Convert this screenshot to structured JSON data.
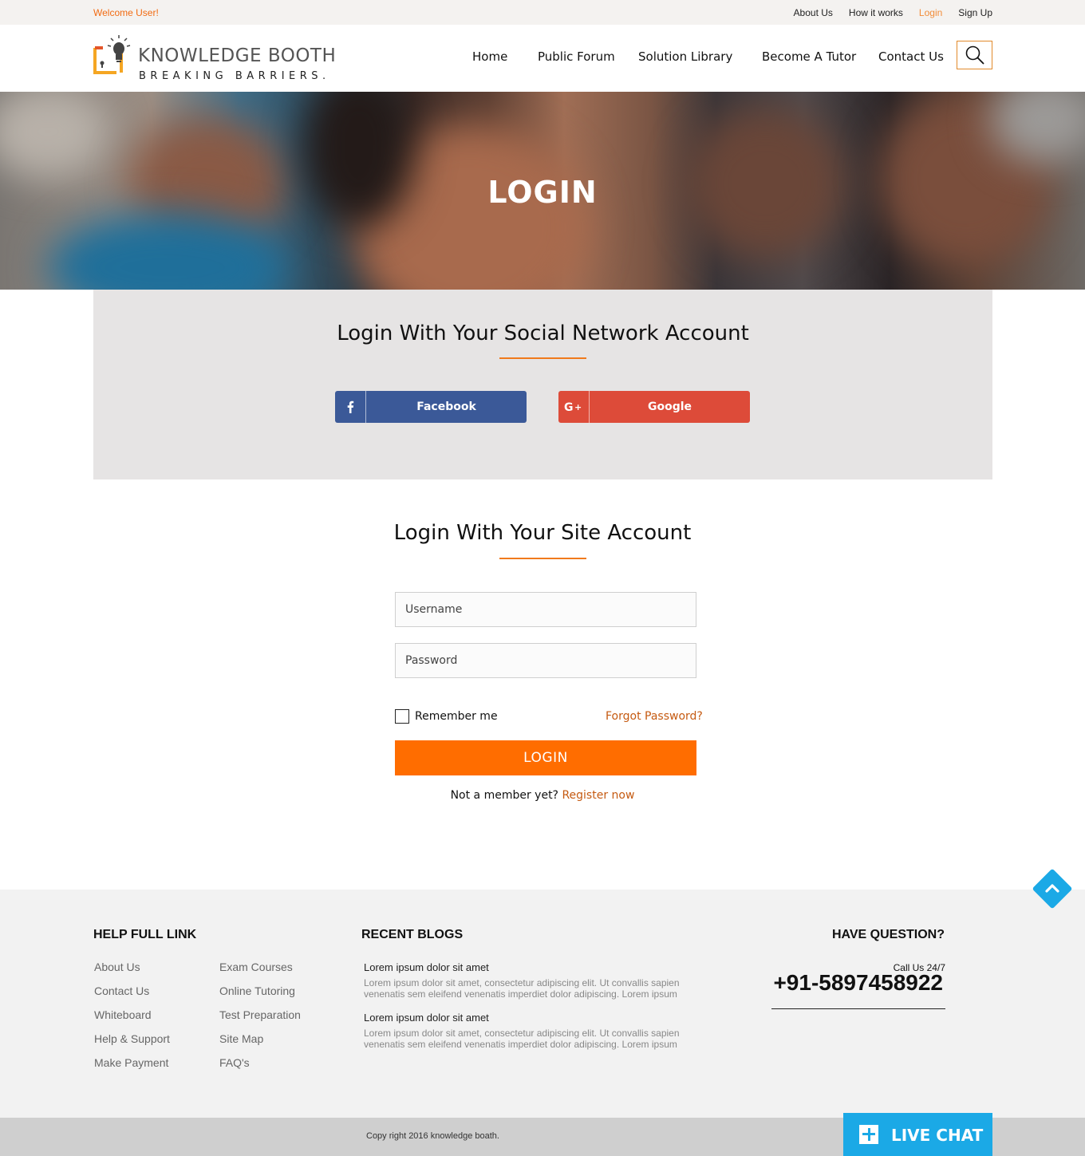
{
  "topbar": {
    "welcome": "Welcome User!",
    "links": [
      "About Us",
      "How it works",
      "Login",
      "Sign Up"
    ]
  },
  "brand": {
    "title": "KNOWLEDGE BOOTH",
    "tagline": "BREAKING BARRIERS."
  },
  "nav": {
    "items": [
      "Home",
      "Public Forum",
      "Solution Library",
      "Become A Tutor",
      "Contact Us"
    ]
  },
  "hero": {
    "title": "LOGIN"
  },
  "social": {
    "heading": "Login With Your Social Network Account",
    "facebook_label": "Facebook",
    "google_label": "Google",
    "facebook_color": "#3b5998",
    "google_color": "#dd4b39"
  },
  "site_login": {
    "heading": "Login With Your Site Account",
    "username_placeholder": "Username",
    "password_placeholder": "Password",
    "remember_label": "Remember me",
    "forgot_label": "Forgot Password?",
    "login_button": "LOGIN",
    "not_member_text": "Not a member yet?",
    "register_label": "Register now"
  },
  "footer": {
    "help_heading": "HELP FULL LINK",
    "help_col1": [
      "About Us",
      "Contact Us",
      "Whiteboard",
      "Help & Support",
      "Make Payment"
    ],
    "help_col2": [
      "Exam Courses",
      "Online Tutoring",
      "Test Preparation",
      "Site Map",
      "FAQ's"
    ],
    "blogs_heading": "RECENT BLOGS",
    "blogs": [
      {
        "title": "Lorem ipsum dolor sit amet",
        "excerpt": "Lorem ipsum dolor sit amet, consectetur adipiscing elit. Ut convallis sapien venenatis sem eleifend venenatis imperdiet dolor adipiscing. Lorem ipsum"
      },
      {
        "title": "Lorem ipsum dolor sit amet",
        "excerpt": "Lorem ipsum dolor sit amet, consectetur adipiscing elit. Ut convallis sapien venenatis sem eleifend venenatis imperdiet dolor adipiscing. Lorem ipsum"
      }
    ],
    "question_heading": "HAVE QUESTION?",
    "call_label": "Call Us 24/7",
    "phone": "+91-5897458922",
    "copyright": "Copy right 2016  knowledge boath."
  },
  "live_chat": {
    "label": "LIVE CHAT"
  },
  "icons": {
    "search": "search-icon",
    "facebook": "facebook-icon",
    "google_plus": "google-plus-icon",
    "scroll_top": "chevron-up-icon",
    "plus": "plus-icon"
  },
  "colors": {
    "accent": "#ff6d00",
    "link_orange": "#c55a11",
    "chat_blue": "#1ba9e6"
  }
}
